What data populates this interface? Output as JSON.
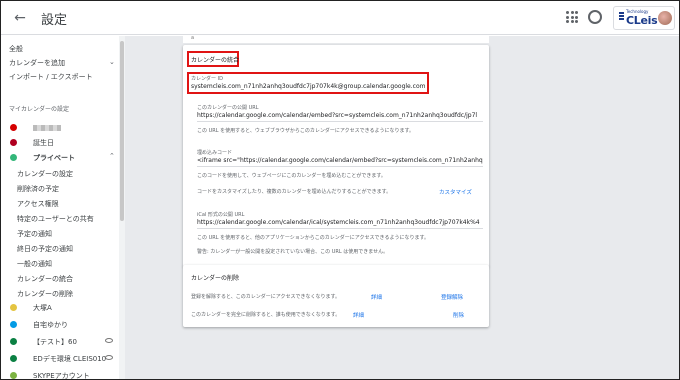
{
  "header": {
    "back_icon": "arrow-back-icon",
    "title": "設定",
    "apps_icon": "apps-grid-icon",
    "account_icon": "account-circle-icon",
    "brand_small": "Technology",
    "brand_text": "CLeis"
  },
  "sidebar": {
    "top_items": [
      {
        "label": "全般"
      },
      {
        "label": "カレンダーを追加"
      },
      {
        "label": "インポート / エクスポート"
      }
    ],
    "section_title": "マイカレンダーの設定",
    "calendars": [
      {
        "label": "",
        "color": "#d50000",
        "blurred": true
      },
      {
        "label": "誕生日",
        "color": "#b00020"
      },
      {
        "label": "プライベート",
        "color": "#33b679"
      }
    ],
    "sub_items": [
      {
        "label": "カレンダーの設定"
      },
      {
        "label": "削除済の予定"
      },
      {
        "label": "アクセス権限"
      },
      {
        "label": "特定のユーザーとの共有"
      },
      {
        "label": "予定の通知"
      },
      {
        "label": "終日の予定の通知"
      },
      {
        "label": "一般の通知"
      },
      {
        "label": "カレンダーの統合"
      },
      {
        "label": "カレンダーの削除"
      }
    ],
    "other_calendars": [
      {
        "label": "大塚A",
        "color": "#e4c441"
      },
      {
        "label": "自宅ゆかり",
        "color": "#039be5"
      },
      {
        "label": "【テスト】60",
        "color": "#0b8043"
      },
      {
        "label": "EDデモ環境 CLEIS010",
        "color": "#0b8043"
      },
      {
        "label": "SKYPEアカウント",
        "color": "#7cb342"
      }
    ]
  },
  "main": {
    "top_fragment": "a",
    "integrate": {
      "section_title": "カレンダーの統合",
      "calendar_id_label": "カレンダー ID",
      "calendar_id_value": "systemcleis.com_n71nh2anhq3oudfdc7jp707k4k@group.calendar.google.com",
      "public_url_label": "このカレンダーの公開 URL",
      "public_url_value": "https://calendar.google.com/calendar/embed?src=systemcleis.com_n71nh2anhq3oudfdc/jp7l",
      "public_url_hint": "この URL を使用すると、ウェブブラウザからこのカレンダーにアクセスできるようになります。",
      "embed_label": "埋め込みコード",
      "embed_value": "<iframe src=\"https://calendar.google.com/calendar/embed?src=systemcleis.com_n71nh2anhq",
      "embed_hint": "このコードを使用して、ウェブページにこのカレンダーを埋め込むことができます。",
      "customize_hint": "コードをカスタマイズしたり、複数のカレンダーを埋め込んだりすることができます。",
      "customize_link": "カスタマイズ",
      "ical_label": "iCal 形式の公開 URL",
      "ical_value": "https://calendar.google.com/calendar/ical/systemcleis.com_n71nh2anhq3oudfdc7jp707k4k%4",
      "ical_hint": "この URL を使用すると、他のアプリケーションからこのカレンダーにアクセスできるようになります。",
      "ical_warning": "警告: カレンダーが一般公開を設定されていない場合、この URL は使用できません。"
    },
    "delete": {
      "section_title": "カレンダーの削除",
      "unsubscribe_text": "登録を解除すると、このカレンダーにアクセスできなくなります。",
      "unsubscribe_detail_link": "詳細",
      "unsubscribe_button": "登録解除",
      "delete_text": "このカレンダーを完全に削除すると、誰も使用できなくなります。",
      "delete_detail_link": "詳細",
      "delete_button": "削除"
    }
  }
}
